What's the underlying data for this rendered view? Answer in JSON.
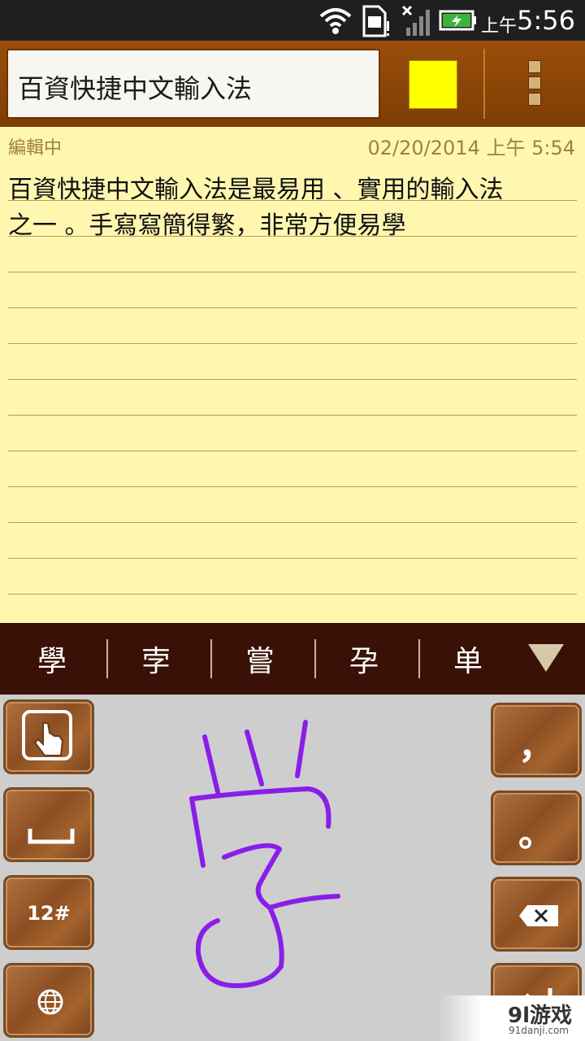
{
  "status_bar": {
    "ampm": "上午",
    "time": "5:56",
    "icons": [
      "wifi-icon",
      "sim-card-icon",
      "signal-icon",
      "battery-charging-icon"
    ]
  },
  "title_bar": {
    "title": "百資快捷中文輸入法",
    "note_color": "#ffff00",
    "menu_icon": "overflow-menu-icon"
  },
  "note": {
    "status": "編輯中",
    "date": "02/20/2014 上午 5:54",
    "line1": "百資快捷中文輸入法是最易用 、實用的輸入法",
    "line2": "之一 。手寫寫簡得繁，非常方便易學"
  },
  "candidates": [
    "學",
    "孛",
    "嘗",
    "孕",
    "单"
  ],
  "keyboard": {
    "left_keys": [
      {
        "name": "handwriting-mode-key",
        "icon": "hand-pointer-icon"
      },
      {
        "name": "space-key",
        "icon": "space-bar-icon"
      },
      {
        "name": "symbols-key",
        "label": "12#"
      },
      {
        "name": "language-key",
        "icon": "globe-icon"
      }
    ],
    "right_keys": [
      {
        "name": "comma-key",
        "label": "，"
      },
      {
        "name": "period-key",
        "label": "。"
      },
      {
        "name": "backspace-key",
        "icon": "backspace-icon"
      },
      {
        "name": "enter-key",
        "icon": "enter-icon"
      }
    ],
    "ink_color": "#8a1ee8"
  },
  "watermark": {
    "text": "9l游戏",
    "sub": "91danji.com"
  }
}
